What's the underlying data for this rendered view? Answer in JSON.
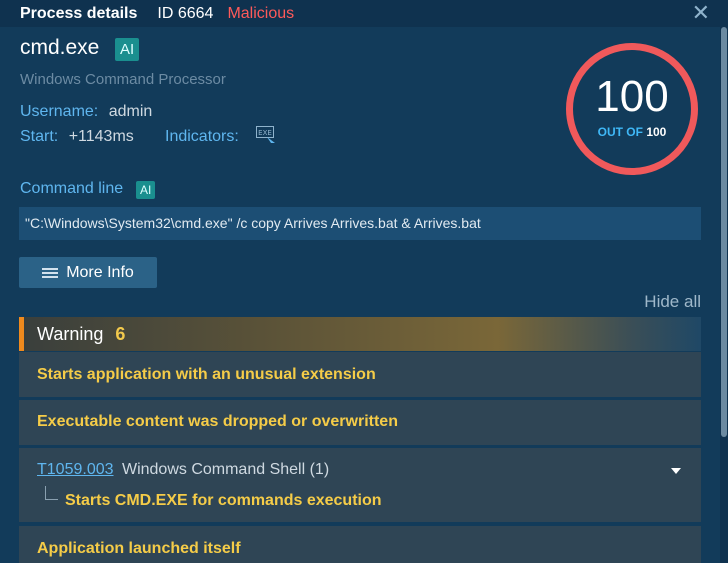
{
  "header": {
    "title": "Process details",
    "id_text": "ID 6664",
    "verdict": "Malicious",
    "close_label": "✕"
  },
  "process": {
    "name": "cmd.exe",
    "ai_badge": "AI",
    "description": "Windows Command Processor",
    "username_label": "Username:",
    "username": "admin",
    "start_label": "Start:",
    "start": "+1143ms",
    "indicators_label": "Indicators:",
    "indicator_icon": "exe-file-icon"
  },
  "score": {
    "value": "100",
    "out_of_label": "OUT OF",
    "max": "100"
  },
  "command_line": {
    "label": "Command line",
    "ai_badge": "AI",
    "value": "\"C:\\Windows\\System32\\cmd.exe\" /c copy Arrives Arrives.bat & Arrives.bat"
  },
  "buttons": {
    "more_info": "More Info",
    "hide_all": "Hide all"
  },
  "warning": {
    "label": "Warning",
    "count": "6",
    "items": [
      {
        "text": "Starts application with an unusual extension"
      },
      {
        "text": "Executable content was dropped or overwritten"
      },
      {
        "technique_id": "T1059.003",
        "technique_name": "Windows Command Shell (1)",
        "sub_text": "Starts CMD.EXE for commands execution"
      },
      {
        "text": "Application launched itself"
      }
    ]
  },
  "colors": {
    "background": "#123b5a",
    "malicious": "#ff5a5a",
    "accent_blue": "#5fb6ef",
    "warning_yellow": "#f5cc48",
    "score_ring": "#f0595b"
  }
}
